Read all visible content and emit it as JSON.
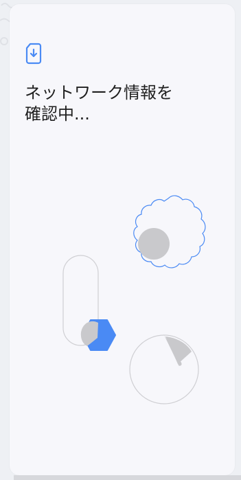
{
  "screen": {
    "title": "ネットワーク情報を\n確認中..."
  },
  "icons": {
    "header_icon": "sim-card-download-icon"
  },
  "colors": {
    "accent": "#4a8af4",
    "shape_gray": "#c9c9cc",
    "outline_gray": "#cfcfd3",
    "card_background": "#f7f7fb",
    "text": "#1f1f1f"
  }
}
